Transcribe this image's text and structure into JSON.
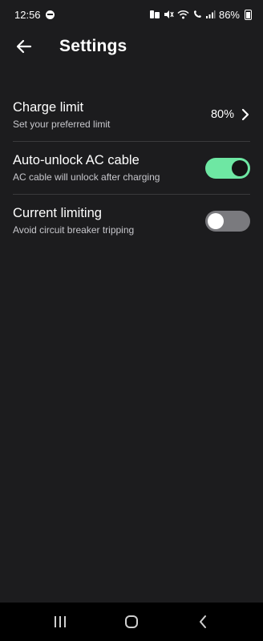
{
  "status_bar": {
    "time": "12:56",
    "battery": "86%",
    "icons": [
      "do-not-disturb-icon",
      "notification-icons",
      "mute-icon",
      "wifi-icon",
      "wifi-calling-icon",
      "signal-icon",
      "battery-icon"
    ]
  },
  "app_bar": {
    "back_icon": "arrow-left-icon",
    "title": "Settings"
  },
  "settings": [
    {
      "title": "Charge limit",
      "subtitle": "Set your preferred limit",
      "value": "80%",
      "icon": "chevron-right-icon"
    },
    {
      "title": "Auto-unlock AC cable",
      "subtitle": "AC cable will unlock after charging",
      "toggle": "on"
    },
    {
      "title": "Current limiting",
      "subtitle": "Avoid circuit breaker tripping",
      "toggle": "off"
    }
  ],
  "colors": {
    "background": "#1c1c1e",
    "toggle_on": "#6ee7a3",
    "toggle_off": "#7a7a7e",
    "divider": "#3a3a3c"
  },
  "nav_bar": {
    "icons": [
      "recent-apps-icon",
      "home-icon",
      "back-icon"
    ]
  }
}
